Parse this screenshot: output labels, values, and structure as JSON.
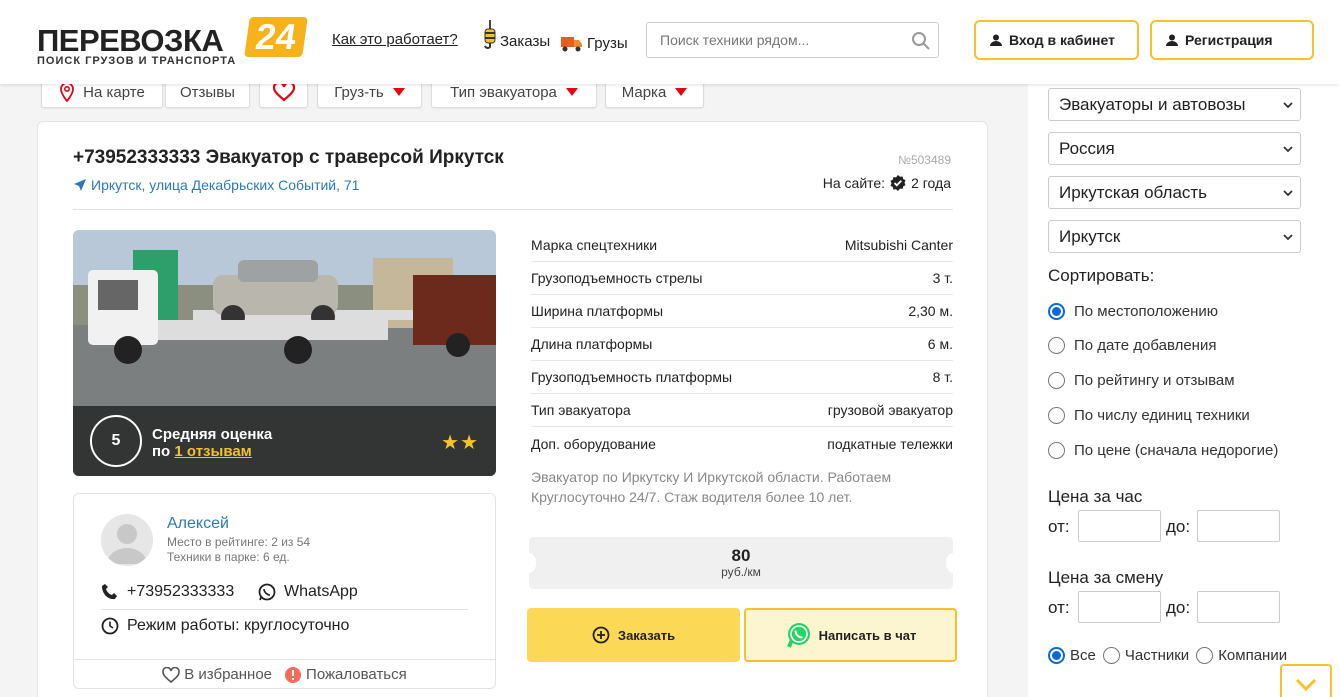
{
  "header": {
    "logo_title": "ПЕРЕВОЗКА",
    "logo_badge": "24",
    "logo_subtitle": "ПОИСК ГРУЗОВ И ТРАНСПОРТА",
    "how_it_works": "Как это работает?",
    "orders": "Заказы",
    "cargo": "Грузы",
    "search_placeholder": "Поиск техники рядом...",
    "login": "Вход в кабинет",
    "register": "Регистрация"
  },
  "filters": {
    "on_map": "На карте",
    "reviews": "Отзывы",
    "capacity": "Груз-ть",
    "tow_type": "Тип эвакуатора",
    "brand": "Марка"
  },
  "listing": {
    "title": "+73952333333 Эвакуатор с траверсой Иркутск",
    "address": "Иркутск, улица Декабрьских Событий, 71",
    "number": "№503489",
    "on_site_label": "На сайте:",
    "on_site_value": "2 года",
    "rating": {
      "score": "5",
      "label_line1": "Средняя оценка",
      "label_prefix": "по",
      "reviews_link": "1 отзывам",
      "stars": "★★",
      "stars_count": 2
    },
    "specs": [
      {
        "label": "Марка спецтехники",
        "value": "Mitsubishi Canter"
      },
      {
        "label": "Грузоподъемность стрелы",
        "value": "3 т."
      },
      {
        "label": "Ширина платформы",
        "value": "2,30 м."
      },
      {
        "label": "Длина платформы",
        "value": "6 м."
      },
      {
        "label": "Грузоподъемность платформы",
        "value": "8 т."
      },
      {
        "label": "Тип эвакуатора",
        "value": "грузовой эвакуатор"
      },
      {
        "label": "Доп. оборудование",
        "value": "подкатные тележки"
      }
    ],
    "description": "Эвакуатор по Иркутску И Иркутской области. Работаем Круглосуточно 24/7. Стаж водителя более 10 лет.",
    "price_value": "80",
    "price_unit": "руб./км",
    "order_button": "Заказать",
    "chat_button": "Написать в чат",
    "seller": {
      "name": "Алексей",
      "rank": "Место в рейтинге: 2 из 54",
      "fleet": "Техники в парке: 6 ед.",
      "phone": "+73952333333",
      "whatsapp": "WhatsApp",
      "hours": "Режим работы: круглосуточно",
      "favorite": "В избранное",
      "complain": "Пожаловаться"
    }
  },
  "sidebar": {
    "selects": [
      "Эвакуаторы и автовозы",
      "Россия",
      "Иркутская область",
      "Иркутск"
    ],
    "sort_title": "Сортировать:",
    "sort_options": [
      {
        "label": "По местоположению",
        "selected": true
      },
      {
        "label": "По дате добавления",
        "selected": false
      },
      {
        "label": "По рейтингу и отзывам",
        "selected": false
      },
      {
        "label": "По числу единиц техники",
        "selected": false
      },
      {
        "label": "По цене (сначала недорогие)",
        "selected": false
      }
    ],
    "price_hour_title": "Цена за час",
    "price_shift_title": "Цена за смену",
    "from_label": "от:",
    "to_label": "до:",
    "who_options": [
      {
        "label": "Все",
        "selected": true
      },
      {
        "label": "Частники",
        "selected": false
      },
      {
        "label": "Компании",
        "selected": false
      }
    ]
  },
  "colors": {
    "brand_yellow": "#f6c229",
    "link_blue": "#2a7ab8",
    "accent_red": "#e30613",
    "order_yellow": "#fcd857",
    "whatsapp_green": "#25d366"
  }
}
